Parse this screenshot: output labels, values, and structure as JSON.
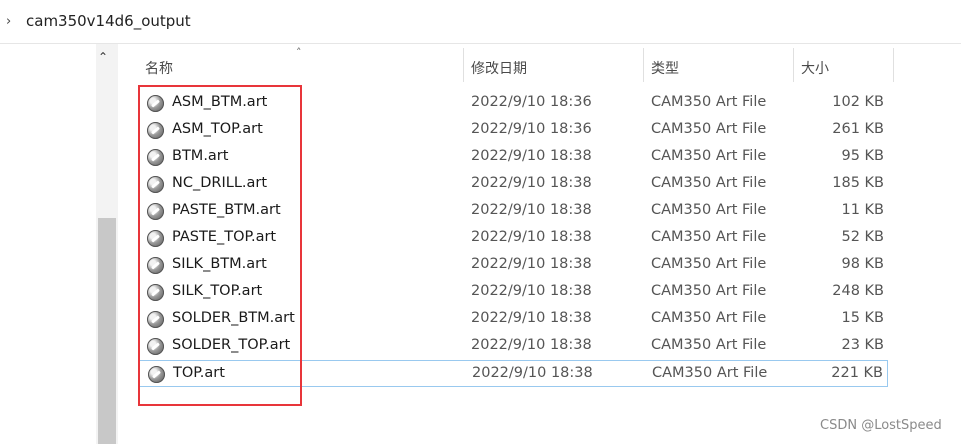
{
  "breadcrumb": {
    "chevron": "›",
    "folder": "cam350v14d6_output"
  },
  "scrollbar": {
    "up_arrow": "⌃"
  },
  "columns": {
    "name": "名称",
    "date": "修改日期",
    "type": "类型",
    "size": "大小",
    "sort_indicator": "˄"
  },
  "files": [
    {
      "name": "ASM_BTM.art",
      "date": "2022/9/10 18:36",
      "type": "CAM350 Art File",
      "size": "102 KB"
    },
    {
      "name": "ASM_TOP.art",
      "date": "2022/9/10 18:36",
      "type": "CAM350 Art File",
      "size": "261 KB"
    },
    {
      "name": "BTM.art",
      "date": "2022/9/10 18:38",
      "type": "CAM350 Art File",
      "size": "95 KB"
    },
    {
      "name": "NC_DRILL.art",
      "date": "2022/9/10 18:38",
      "type": "CAM350 Art File",
      "size": "185 KB"
    },
    {
      "name": "PASTE_BTM.art",
      "date": "2022/9/10 18:38",
      "type": "CAM350 Art File",
      "size": "11 KB"
    },
    {
      "name": "PASTE_TOP.art",
      "date": "2022/9/10 18:38",
      "type": "CAM350 Art File",
      "size": "52 KB"
    },
    {
      "name": "SILK_BTM.art",
      "date": "2022/9/10 18:38",
      "type": "CAM350 Art File",
      "size": "98 KB"
    },
    {
      "name": "SILK_TOP.art",
      "date": "2022/9/10 18:38",
      "type": "CAM350 Art File",
      "size": "248 KB"
    },
    {
      "name": "SOLDER_BTM.art",
      "date": "2022/9/10 18:38",
      "type": "CAM350 Art File",
      "size": "15 KB"
    },
    {
      "name": "SOLDER_TOP.art",
      "date": "2022/9/10 18:38",
      "type": "CAM350 Art File",
      "size": "23 KB"
    },
    {
      "name": "TOP.art",
      "date": "2022/9/10 18:38",
      "type": "CAM350 Art File",
      "size": "221 KB"
    }
  ],
  "selected_file": "TOP.art",
  "file_icon": "cam350-art-file-icon",
  "highlight_color": "#e8353a",
  "watermark": "CSDN @LostSpeed"
}
